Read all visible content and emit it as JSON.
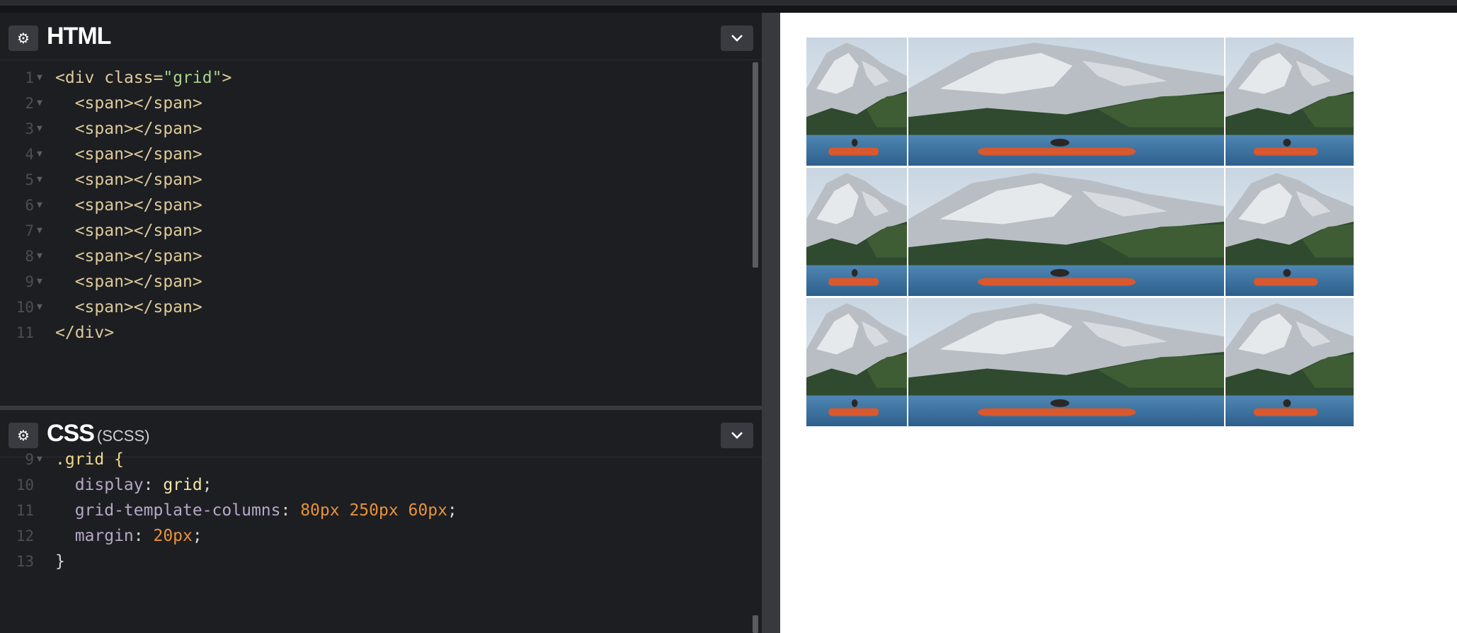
{
  "html_panel": {
    "title": "HTML",
    "lines": [
      {
        "n": "1",
        "parts": [
          [
            "tag",
            "<div "
          ],
          [
            "attr",
            "class="
          ],
          [
            "str",
            "\"grid\""
          ],
          [
            "tag",
            ">"
          ]
        ]
      },
      {
        "n": "2",
        "parts": [
          [
            "tag",
            "  <span></span>"
          ]
        ]
      },
      {
        "n": "3",
        "parts": [
          [
            "tag",
            "  <span></span>"
          ]
        ]
      },
      {
        "n": "4",
        "parts": [
          [
            "tag",
            "  <span></span>"
          ]
        ]
      },
      {
        "n": "5",
        "parts": [
          [
            "tag",
            "  <span></span>"
          ]
        ]
      },
      {
        "n": "6",
        "parts": [
          [
            "tag",
            "  <span></span>"
          ]
        ]
      },
      {
        "n": "7",
        "parts": [
          [
            "tag",
            "  <span></span>"
          ]
        ]
      },
      {
        "n": "8",
        "parts": [
          [
            "tag",
            "  <span></span>"
          ]
        ]
      },
      {
        "n": "9",
        "parts": [
          [
            "tag",
            "  <span></span>"
          ]
        ]
      },
      {
        "n": "10",
        "parts": [
          [
            "tag",
            "  <span></span>"
          ]
        ]
      },
      {
        "n": "11",
        "parts": [
          [
            "tag",
            "</div>"
          ]
        ]
      }
    ]
  },
  "css_panel": {
    "title": "CSS",
    "subtitle": "(SCSS)",
    "lines": [
      {
        "n": "9",
        "parts": [
          [
            "sel",
            ".grid {"
          ]
        ]
      },
      {
        "n": "10",
        "parts": [
          [
            "prop",
            "  display"
          ],
          [
            "plain",
            ": "
          ],
          [
            "kw",
            "grid"
          ],
          [
            "plain",
            ";"
          ]
        ]
      },
      {
        "n": "11",
        "parts": [
          [
            "prop",
            "  grid-template-columns"
          ],
          [
            "plain",
            ": "
          ],
          [
            "num",
            "80px 250px 60px"
          ],
          [
            "plain",
            ";"
          ]
        ]
      },
      {
        "n": "12",
        "parts": [
          [
            "prop",
            "  margin"
          ],
          [
            "plain",
            ": "
          ],
          [
            "num",
            "20px"
          ],
          [
            "plain",
            ";"
          ]
        ]
      },
      {
        "n": "13",
        "parts": [
          [
            "plain",
            "}"
          ]
        ]
      }
    ]
  },
  "icons": {
    "settings": "gear-icon",
    "collapse": "chevron-down-icon"
  },
  "preview": {
    "tile_count": 9,
    "image_subject": "mountain-lake-kayak-photo"
  },
  "colors": {
    "editor_bg": "#1d1e22",
    "tag": "#dccb9a",
    "string": "#a7d48a",
    "number": "#e8923a",
    "property": "#b7a8c6"
  }
}
